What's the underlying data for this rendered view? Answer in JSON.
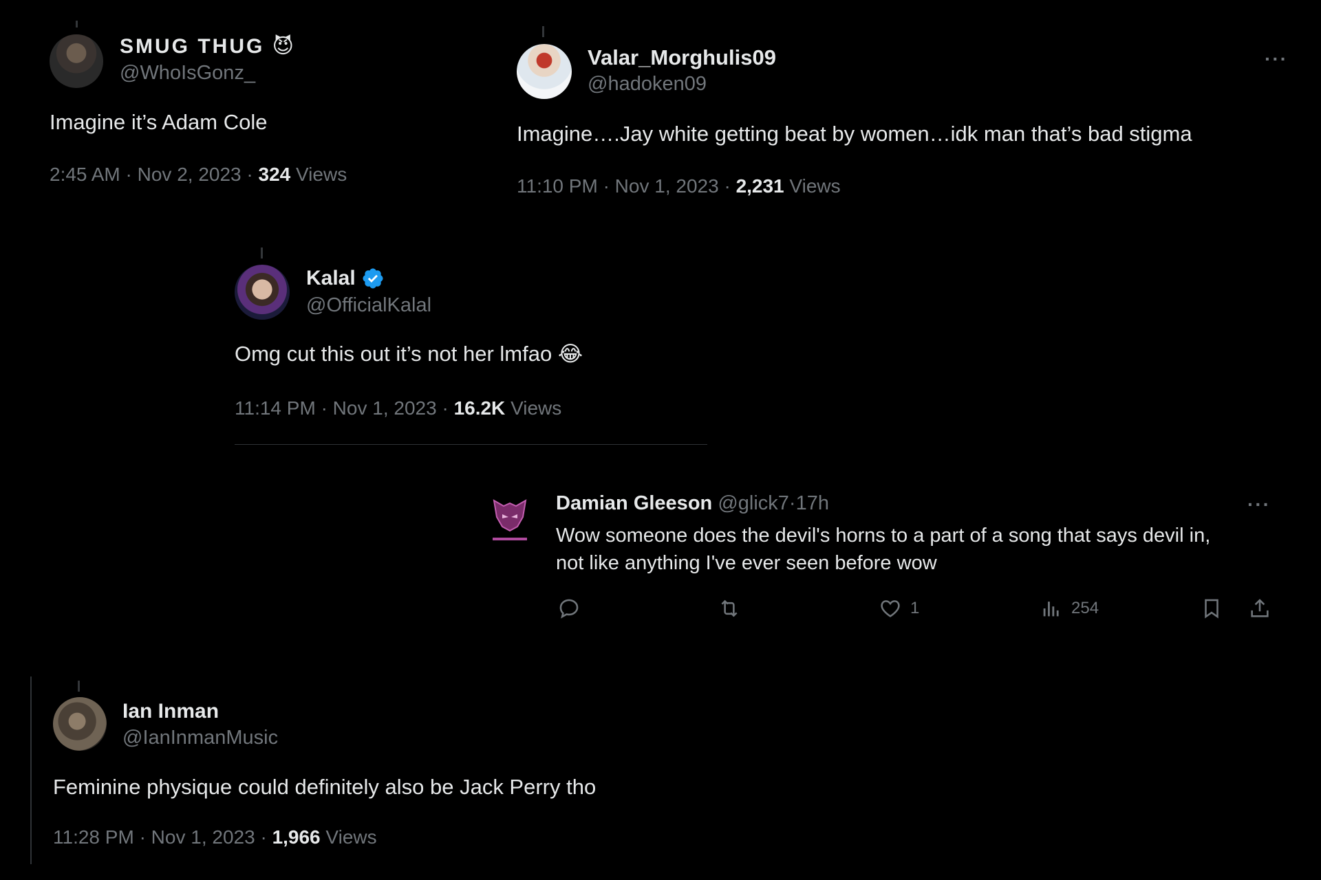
{
  "tweet1": {
    "name": "SMUG THUG",
    "name_emoji": "😈",
    "handle": "@WhoIsGonz_",
    "text": "Imagine it’s Adam Cole",
    "time": "2:45 AM",
    "date": "Nov 2, 2023",
    "views_count": "324",
    "views_label": "Views"
  },
  "tweet2": {
    "name": "Valar_Morghulis09",
    "handle": "@hadoken09",
    "text": "Imagine….Jay white getting beat by women…idk man that’s bad stigma",
    "time": "11:10 PM",
    "date": "Nov 1, 2023",
    "views_count": "2,231",
    "views_label": "Views",
    "more": "···"
  },
  "tweet3": {
    "name": "Kalal",
    "handle": "@OfficialKalal",
    "text": "Omg cut this out it’s not her lmfao",
    "emoji": "😂",
    "time": "11:14 PM",
    "date": "Nov 1, 2023",
    "views_count": "16.2K",
    "views_label": "Views"
  },
  "tweet4": {
    "name": "Damian Gleeson",
    "handle": "@glick7",
    "age": "17h",
    "text_line1": "Wow someone does the devil's horns to a part of a song that says devil in,",
    "text_line2": "not like anything I've ever seen before wow",
    "likes": "1",
    "views": "254",
    "more": "···"
  },
  "tweet5": {
    "name": "Ian Inman",
    "handle": "@IanInmanMusic",
    "text": "Feminine physique could definitely also be Jack Perry tho",
    "time": "11:28 PM",
    "date": "Nov 1, 2023",
    "views_count": "1,966",
    "views_label": "Views"
  },
  "separator": "·",
  "colors": {
    "background": "#000000",
    "text": "#e7e9ea",
    "secondary": "#71767b",
    "verified": "#1d9bf0"
  }
}
